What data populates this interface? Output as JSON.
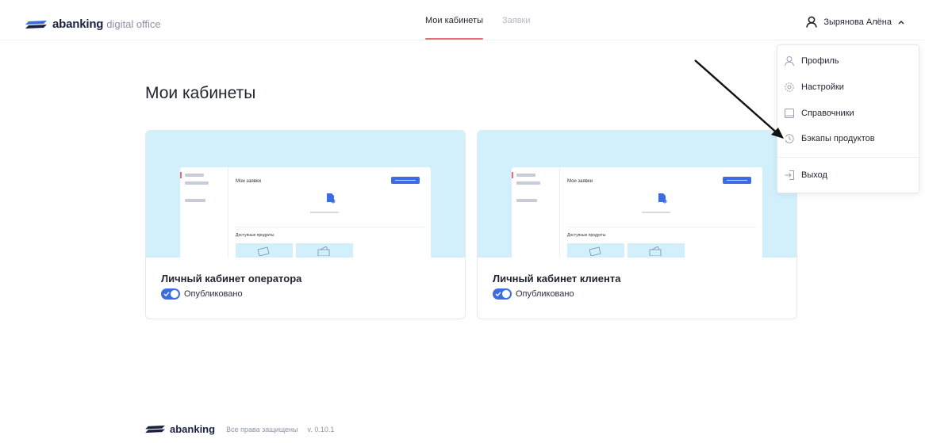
{
  "header": {
    "logo_brand": "abanking",
    "logo_sub": "digital office",
    "tabs": [
      {
        "label": "Мои кабинеты",
        "active": true
      },
      {
        "label": "Заявки",
        "active": false
      }
    ],
    "user_name": "Зырянова Алёна",
    "accent_color": "#e96b74"
  },
  "user_menu": {
    "items": [
      {
        "label": "Профиль",
        "icon": "user-icon"
      },
      {
        "label": "Настройки",
        "icon": "gear-icon"
      },
      {
        "label": "Справочники",
        "icon": "book-icon"
      },
      {
        "label": "Бэкапы продуктов",
        "icon": "history-icon"
      },
      {
        "label": "Выход",
        "icon": "logout-icon"
      }
    ]
  },
  "main": {
    "title": "Мои кабинеты",
    "cards": [
      {
        "title": "Личный кабинет оператора",
        "status": "Опубликовано",
        "published": true,
        "preview": {
          "heading": "Мои заявки",
          "section": "Доступные продукты"
        }
      },
      {
        "title": "Личный кабинет клиента",
        "status": "Опубликовано",
        "published": true,
        "preview": {
          "heading": "Мои заявки",
          "section": "Доступные продукты"
        }
      }
    ]
  },
  "footer": {
    "brand": "abanking",
    "rights": "Все права защищены",
    "version": "v. 0.10.1"
  },
  "colors": {
    "primary": "#3d6be0",
    "preview_bg": "#d2f0fc",
    "brand_dark": "#1b2140"
  }
}
